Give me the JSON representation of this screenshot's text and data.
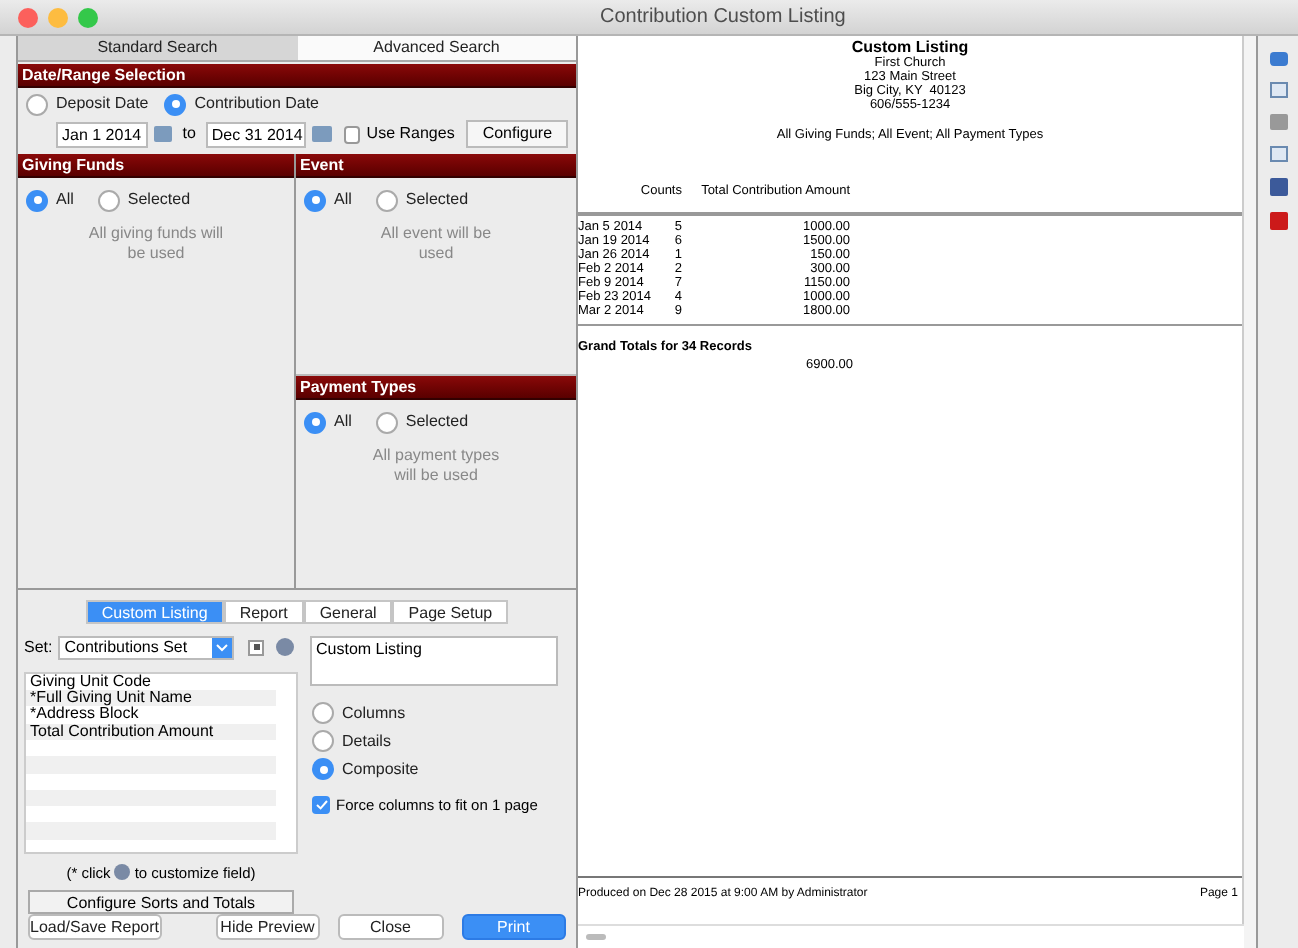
{
  "window": {
    "title": "Contribution Custom Listing"
  },
  "search_tabs": [
    {
      "label": "Standard Search",
      "selected": true
    },
    {
      "label": "Advanced Search",
      "selected": false
    }
  ],
  "date_range": {
    "header": "Date/Range Selection",
    "options": [
      {
        "label": "Deposit Date",
        "selected": false
      },
      {
        "label": "Contribution Date",
        "selected": true
      }
    ],
    "from": "Jan 1 2014",
    "to_label": "to",
    "to": "Dec 31 2014",
    "use_ranges": {
      "label": "Use Ranges",
      "checked": false
    },
    "configure": "Configure"
  },
  "giving_funds": {
    "header": "Giving Funds",
    "options": [
      {
        "label": "All",
        "selected": true
      },
      {
        "label": "Selected",
        "selected": false
      }
    ],
    "note": "All giving funds will be used"
  },
  "event": {
    "header": "Event",
    "options": [
      {
        "label": "All",
        "selected": true
      },
      {
        "label": "Selected",
        "selected": false
      }
    ],
    "note": "All event will be used"
  },
  "payment_types": {
    "header": "Payment Types",
    "options": [
      {
        "label": "All",
        "selected": true
      },
      {
        "label": "Selected",
        "selected": false
      }
    ],
    "note": "All payment types will be used"
  },
  "listing_tabs": [
    {
      "label": "Custom Listing",
      "selected": true
    },
    {
      "label": "Report",
      "selected": false
    },
    {
      "label": "General",
      "selected": false
    },
    {
      "label": "Page Setup",
      "selected": false
    }
  ],
  "set": {
    "label": "Set:",
    "value": "Contributions Set"
  },
  "fields": [
    "Giving Unit Code",
    "*Full Giving Unit Name",
    "*Address Block",
    "Total Contribution Amount"
  ],
  "listing_title": "Custom Listing",
  "layout_options": [
    {
      "label": "Columns",
      "selected": false
    },
    {
      "label": "Details",
      "selected": false
    },
    {
      "label": "Composite",
      "selected": true
    }
  ],
  "force_columns": {
    "label": "Force columns to fit on 1 page",
    "checked": true
  },
  "hint": {
    "before": "(* click",
    "after": "to customize field)"
  },
  "configure_sorts": "Configure Sorts and Totals",
  "buttons": [
    {
      "label": "Load/Save Report",
      "primary": false
    },
    {
      "label": "Hide Preview",
      "primary": false
    },
    {
      "label": "Close",
      "primary": false
    },
    {
      "label": "Print",
      "primary": true
    }
  ],
  "report": {
    "title": "Custom Listing",
    "lines": [
      "First Church",
      "123 Main Street",
      "Big City, KY  40123",
      "606/555-1234"
    ],
    "filter": "All Giving Funds; All Event; All Payment Types",
    "columns": [
      "",
      "Counts",
      "Total Contribution Amount"
    ],
    "rows": [
      [
        "Jan 5 2014",
        "5",
        "1000.00"
      ],
      [
        "Jan 19 2014",
        "6",
        "1500.00"
      ],
      [
        "Jan 26 2014",
        "1",
        "150.00"
      ],
      [
        "Feb 2 2014",
        "2",
        "300.00"
      ],
      [
        "Feb 9 2014",
        "7",
        "1150.00"
      ],
      [
        "Feb 23 2014",
        "4",
        "1000.00"
      ],
      [
        "Mar 2 2014",
        "9",
        "1800.00"
      ]
    ],
    "grand_label": "Grand Totals for 34 Records",
    "grand_total": "6900.00",
    "footer_left": "Produced on Dec 28 2015 at 9:00 AM by Administrator",
    "footer_right": "Page 1"
  }
}
